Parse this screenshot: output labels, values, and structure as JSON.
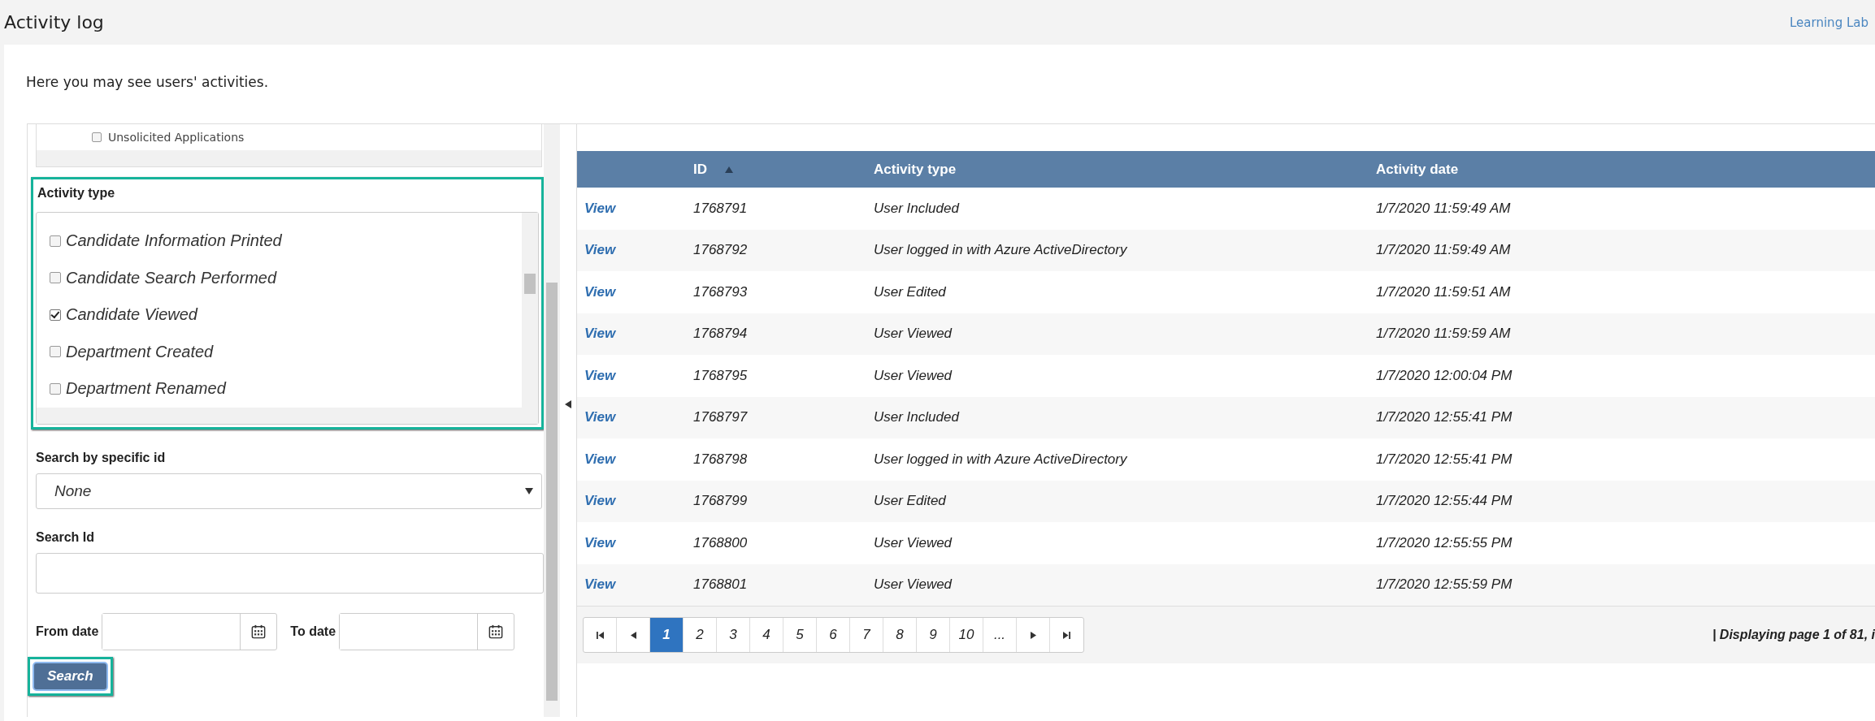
{
  "header": {
    "title": "Activity log",
    "link": "Learning Lab"
  },
  "intro": "Here you may see users' activities.",
  "filters": {
    "tree_items": [
      {
        "label": "Unsolicited Applications",
        "checked": false
      }
    ],
    "activity_type": {
      "label": "Activity type",
      "options": [
        {
          "label": "Candidate Information Printed",
          "checked": false
        },
        {
          "label": "Candidate Search Performed",
          "checked": false
        },
        {
          "label": "Candidate Viewed",
          "checked": true
        },
        {
          "label": "Department Created",
          "checked": false
        },
        {
          "label": "Department Renamed",
          "checked": false
        }
      ]
    },
    "specific_id": {
      "label": "Search by specific id",
      "value": "None"
    },
    "search_id": {
      "label": "Search Id"
    },
    "from_date": {
      "label": "From date"
    },
    "to_date": {
      "label": "To date"
    },
    "search_button": "Search"
  },
  "table": {
    "columns": [
      {
        "label": "ID",
        "sorted_ascending": true
      },
      {
        "label": "Activity type",
        "sorted_ascending": false
      },
      {
        "label": "Activity date",
        "sorted_ascending": false
      }
    ],
    "rows": [
      {
        "link": "View",
        "id": "1768791",
        "type": "User Included",
        "date": "1/7/2020 11:59:49 AM"
      },
      {
        "link": "View",
        "id": "1768792",
        "type": "User logged in with Azure ActiveDirectory",
        "date": "1/7/2020 11:59:49 AM"
      },
      {
        "link": "View",
        "id": "1768793",
        "type": "User Edited",
        "date": "1/7/2020 11:59:51 AM"
      },
      {
        "link": "View",
        "id": "1768794",
        "type": "User Viewed",
        "date": "1/7/2020 11:59:59 AM"
      },
      {
        "link": "View",
        "id": "1768795",
        "type": "User Viewed",
        "date": "1/7/2020 12:00:04 PM"
      },
      {
        "link": "View",
        "id": "1768797",
        "type": "User Included",
        "date": "1/7/2020 12:55:41 PM"
      },
      {
        "link": "View",
        "id": "1768798",
        "type": "User logged in with Azure ActiveDirectory",
        "date": "1/7/2020 12:55:41 PM"
      },
      {
        "link": "View",
        "id": "1768799",
        "type": "User Edited",
        "date": "1/7/2020 12:55:44 PM"
      },
      {
        "link": "View",
        "id": "1768800",
        "type": "User Viewed",
        "date": "1/7/2020 12:55:55 PM"
      },
      {
        "link": "View",
        "id": "1768801",
        "type": "User Viewed",
        "date": "1/7/2020 12:55:59 PM"
      }
    ]
  },
  "pagination": {
    "pages": [
      {
        "label": "1",
        "selected": true
      },
      {
        "label": "2",
        "selected": false
      },
      {
        "label": "3",
        "selected": false
      },
      {
        "label": "4",
        "selected": false
      },
      {
        "label": "5",
        "selected": false
      },
      {
        "label": "6",
        "selected": false
      },
      {
        "label": "7",
        "selected": false
      },
      {
        "label": "8",
        "selected": false
      },
      {
        "label": "9",
        "selected": false
      },
      {
        "label": "10",
        "selected": false
      },
      {
        "label": "...",
        "selected": false
      }
    ],
    "summary": "| Displaying page 1 of 81, i"
  }
}
